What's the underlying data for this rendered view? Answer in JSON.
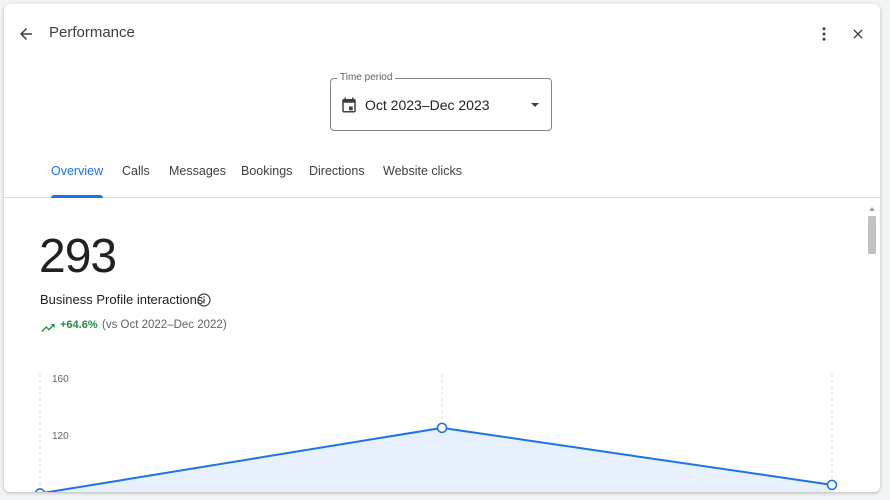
{
  "header": {
    "title": "Performance"
  },
  "time_period": {
    "label": "Time period",
    "value": "Oct 2023–Dec 2023"
  },
  "tabs": [
    {
      "label": "Overview",
      "active": true
    },
    {
      "label": "Calls",
      "active": false
    },
    {
      "label": "Messages",
      "active": false
    },
    {
      "label": "Bookings",
      "active": false
    },
    {
      "label": "Directions",
      "active": false
    },
    {
      "label": "Website clicks",
      "active": false
    }
  ],
  "summary": {
    "value": "293",
    "label": "Business Profile interactions",
    "change": "+64.6%",
    "comparison": "(vs Oct 2022–Dec 2022)"
  },
  "colors": {
    "accent": "#1a73e8",
    "positive": "#1e8e3e",
    "area_fill": "#e8f0fe"
  },
  "icons": [
    "back-arrow-icon",
    "more-vert-icon",
    "close-icon",
    "calendar-icon",
    "dropdown-arrow-icon",
    "info-icon",
    "trending-up-icon"
  ],
  "chart_data": {
    "type": "area",
    "series": [
      {
        "values": [
          79,
          125,
          85
        ]
      }
    ],
    "y_ticks": [
      "160",
      "120"
    ],
    "ylim": [
      80,
      160
    ],
    "grid": true
  }
}
